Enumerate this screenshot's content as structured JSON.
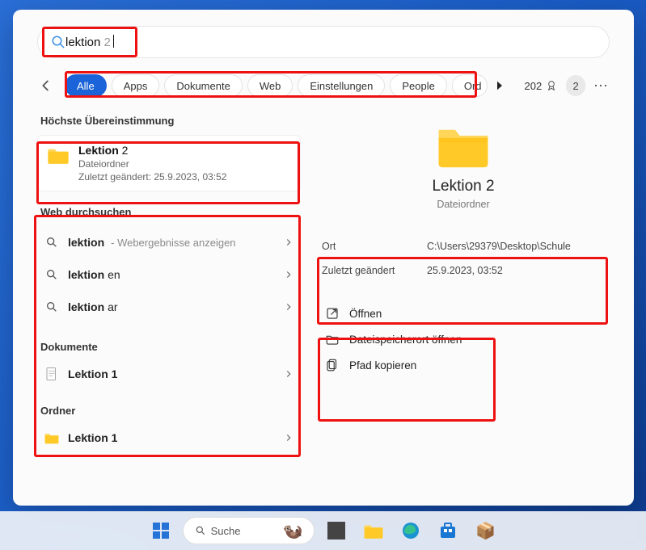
{
  "search": {
    "typed": "lektion",
    "ghost_suffix": " 2"
  },
  "tabs": {
    "items": [
      "Alle",
      "Apps",
      "Dokumente",
      "Web",
      "Einstellungen",
      "People",
      "Ord"
    ],
    "active_index": 0
  },
  "rewards": {
    "points": "202",
    "badge": "2"
  },
  "sections": {
    "best_match_header": "Höchste Übereinstimmung",
    "web_header": "Web durchsuchen",
    "docs_header": "Dokumente",
    "folders_header": "Ordner"
  },
  "best_match": {
    "title_plain": "Lektion",
    "title_suffix": " 2",
    "type": "Dateiordner",
    "modified_label": "Zuletzt geändert: 25.9.2023, 03:52"
  },
  "web_results": [
    {
      "term": "lektion",
      "suffix": "",
      "extra": " - Webergebnisse anzeigen"
    },
    {
      "term": "lektion",
      "suffix": "en",
      "extra": ""
    },
    {
      "term": "lektion",
      "suffix": "ar",
      "extra": ""
    }
  ],
  "doc_results": [
    {
      "label": "Lektion 1"
    }
  ],
  "folder_results": [
    {
      "label": "Lektion 1"
    }
  ],
  "preview": {
    "title": "Lektion 2",
    "subtitle": "Dateiordner",
    "loc_key": "Ort",
    "loc_val": "C:\\Users\\29379\\Desktop\\Schule",
    "mod_key": "Zuletzt geändert",
    "mod_val": "25.9.2023, 03:52",
    "actions": {
      "open": "Öffnen",
      "open_loc": "Dateispeicherort öffnen",
      "copy_path": "Pfad kopieren"
    }
  },
  "taskbar": {
    "search_label": "Suche"
  }
}
